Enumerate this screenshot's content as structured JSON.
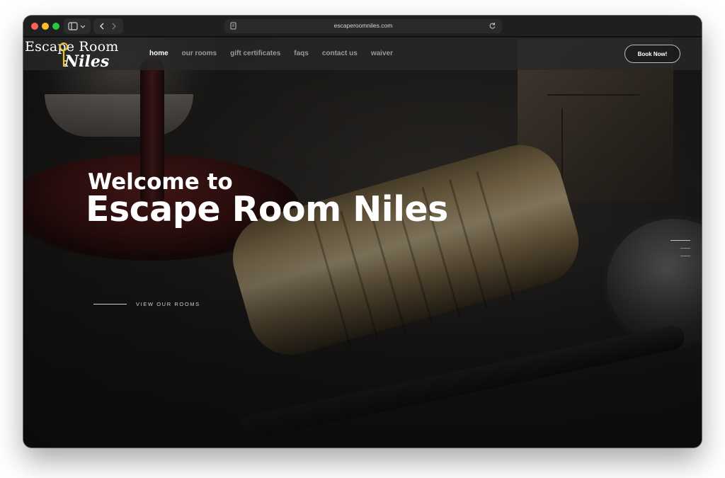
{
  "browser": {
    "url": "escaperoomniles.com"
  },
  "site": {
    "logo": {
      "line1": "Escape Room",
      "line2": "Niles"
    },
    "nav": [
      {
        "label": "home",
        "active": true
      },
      {
        "label": "our rooms",
        "active": false
      },
      {
        "label": "gift certificates",
        "active": false
      },
      {
        "label": "faqs",
        "active": false
      },
      {
        "label": "contact us",
        "active": false
      },
      {
        "label": "waiver",
        "active": false
      }
    ],
    "book_button": "Book Now!"
  },
  "hero": {
    "subtitle": "Welcome to",
    "title": "Escape Room Niles",
    "cta": "VIEW OUR ROOMS"
  },
  "colors": {
    "accent_key": "#e6c23a",
    "header_bg": "#282828"
  },
  "icons": {
    "sidebar": "sidebar-icon",
    "back": "chevron-left-icon",
    "forward": "chevron-right-icon",
    "page": "page-icon",
    "reload": "reload-icon"
  }
}
